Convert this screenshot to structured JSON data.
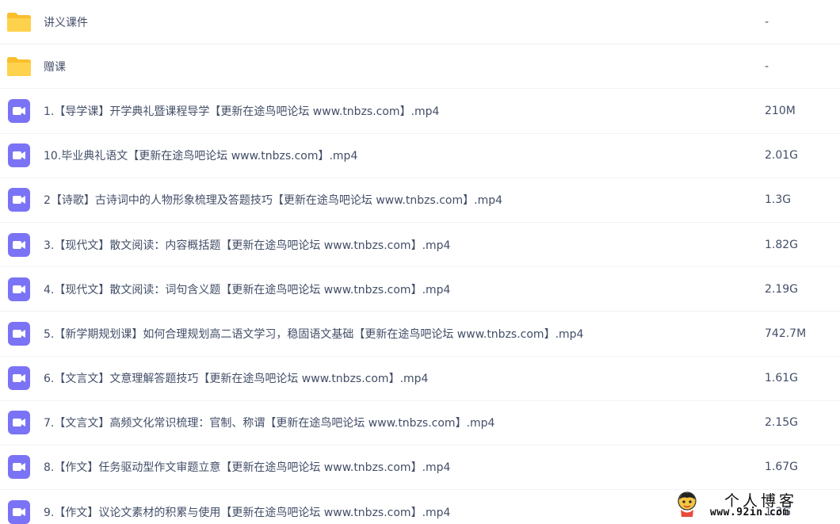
{
  "files": [
    {
      "type": "folder",
      "icon": "folder-icon",
      "name": "讲义课件",
      "size": "-"
    },
    {
      "type": "folder",
      "icon": "folder-icon",
      "name": "赠课",
      "size": "-"
    },
    {
      "type": "video",
      "icon": "video-file-icon",
      "name": "1.【导学课】开学典礼暨课程导学【更新在途鸟吧论坛 www.tnbzs.com】.mp4",
      "size": "210M"
    },
    {
      "type": "video",
      "icon": "video-file-icon",
      "name": "10.毕业典礼语文【更新在途鸟吧论坛 www.tnbzs.com】.mp4",
      "size": "2.01G"
    },
    {
      "type": "video",
      "icon": "video-file-icon",
      "name": "2【诗歌】古诗词中的人物形象梳理及答题技巧【更新在途鸟吧论坛 www.tnbzs.com】.mp4",
      "size": "1.3G"
    },
    {
      "type": "video",
      "icon": "video-file-icon",
      "name": "3.【现代文】散文阅读：内容概括题【更新在途鸟吧论坛 www.tnbzs.com】.mp4",
      "size": "1.82G"
    },
    {
      "type": "video",
      "icon": "video-file-icon",
      "name": "4.【现代文】散文阅读：词句含义题【更新在途鸟吧论坛 www.tnbzs.com】.mp4",
      "size": "2.19G"
    },
    {
      "type": "video",
      "icon": "video-file-icon",
      "name": "5.【新学期规划课】如何合理规划高二语文学习，稳固语文基础【更新在途鸟吧论坛 www.tnbzs.com】.mp4",
      "size": "742.7M"
    },
    {
      "type": "video",
      "icon": "video-file-icon",
      "name": "6.【文言文】文意理解答题技巧【更新在途鸟吧论坛 www.tnbzs.com】.mp4",
      "size": "1.61G"
    },
    {
      "type": "video",
      "icon": "video-file-icon",
      "name": "7.【文言文】高频文化常识梳理：官制、称谓【更新在途鸟吧论坛 www.tnbzs.com】.mp4",
      "size": "2.15G"
    },
    {
      "type": "video",
      "icon": "video-file-icon",
      "name": "8.【作文】任务驱动型作文审题立意【更新在途鸟吧论坛 www.tnbzs.com】.mp4",
      "size": "1.67G"
    },
    {
      "type": "video",
      "icon": "video-file-icon",
      "name": "9.【作文】议论文素材的积累与使用【更新在途鸟吧论坛 www.tnbzs.com】.mp4",
      "size": "1.3G"
    }
  ],
  "watermark": {
    "title": "个人博客",
    "url": "www.92in.com"
  },
  "colors": {
    "folder": "#ffd24d",
    "folder_tab": "#f9bf2c",
    "video": "#7b73f5",
    "text": "#424e67",
    "divider": "#f1f2f4"
  }
}
